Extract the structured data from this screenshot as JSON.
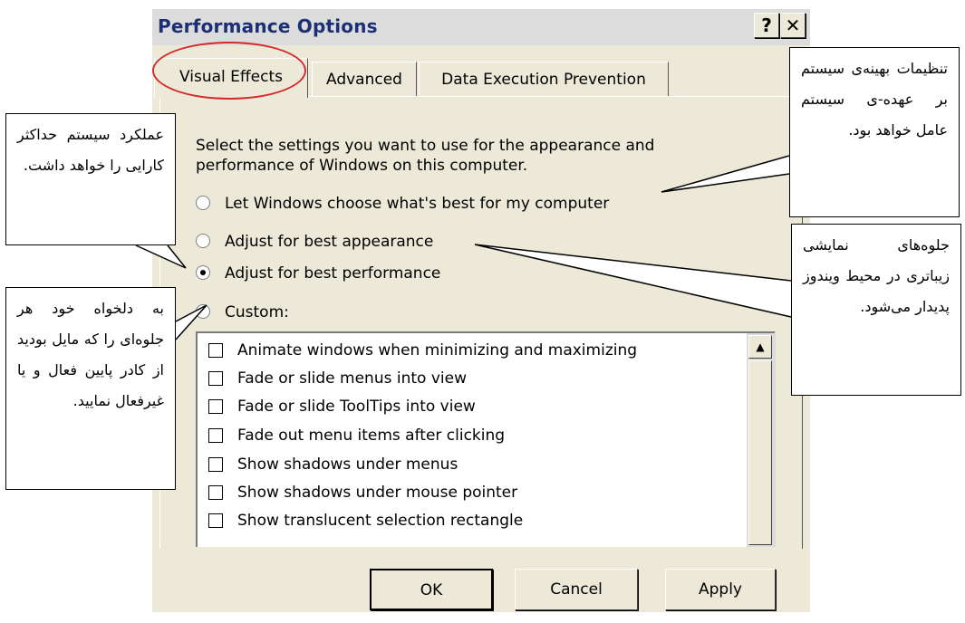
{
  "dialog": {
    "title": "Performance Options",
    "help_button": "?",
    "close_button": "✕",
    "tabs": [
      {
        "label": "Visual Effects"
      },
      {
        "label": "Advanced"
      },
      {
        "label": "Data Execution Prevention"
      }
    ],
    "intro": "Select the settings you want to use for the appearance and performance of Windows on this computer.",
    "options": [
      {
        "label": "Let Windows choose what's best for my computer"
      },
      {
        "label": "Adjust for best appearance"
      },
      {
        "label": "Adjust for best performance"
      },
      {
        "label": "Custom:"
      }
    ],
    "selected_option": "Adjust for best performance",
    "effects": [
      {
        "label": "Animate windows when minimizing and maximizing"
      },
      {
        "label": "Fade or slide menus into view"
      },
      {
        "label": "Fade or slide ToolTips into view"
      },
      {
        "label": "Fade out menu items after clicking"
      },
      {
        "label": "Show shadows under menus"
      },
      {
        "label": "Show shadows under mouse pointer"
      },
      {
        "label": "Show translucent selection rectangle"
      }
    ],
    "buttons": {
      "ok": "OK",
      "cancel": "Cancel",
      "apply": "Apply"
    }
  },
  "callouts": {
    "let_windows": "تنظیمات بهینه‌ی سیستم بر عهده-ی سیستم عامل خواهد بود.",
    "best_performance": "عملکرد سیستم حداکثر کارایی را خواهد داشت.",
    "best_appearance": "جلوه‌های نمایشی زیباتری در محیط ویندوز پدیدار می‌شود.",
    "custom": "به دلخواه خود هر جلوه‌ای را که مایل بودید از کادر پایین فعال و یا غیرفعال نمایید."
  },
  "colors": {
    "title_text": "#1b2f74",
    "highlight_ellipse": "#d42a2a",
    "dialog_face": "#ece9d8"
  }
}
